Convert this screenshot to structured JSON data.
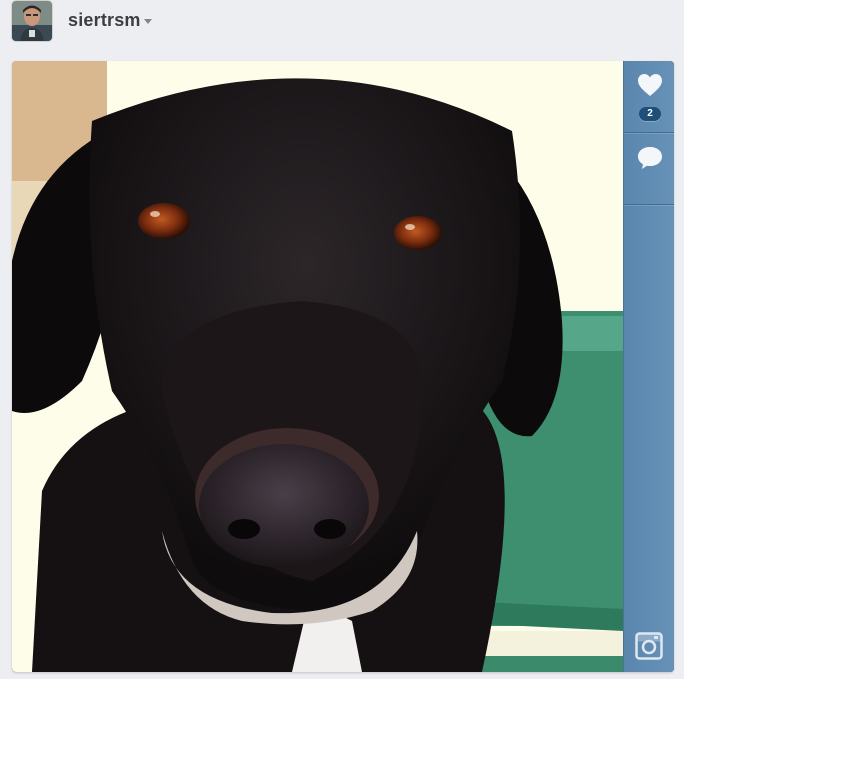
{
  "user": {
    "username": "siertrsm"
  },
  "post": {
    "like_count": "2"
  },
  "icons": {
    "avatar": "user-avatar",
    "caret": "chevron-down-icon",
    "like": "heart-icon",
    "comment": "comment-bubble-icon",
    "app": "instagram-camera-icon"
  },
  "colors": {
    "sidebar": "#6592b8",
    "badge": "#1f4e78",
    "background": "#eceef1"
  }
}
